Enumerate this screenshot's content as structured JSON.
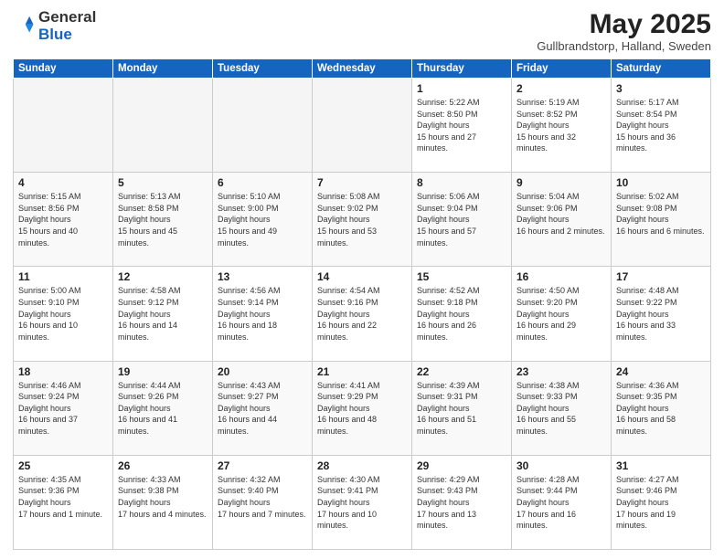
{
  "header": {
    "logo": {
      "line1": "General",
      "line2": "Blue"
    },
    "title": "May 2025",
    "subtitle": "Gullbrandstorp, Halland, Sweden"
  },
  "weekdays": [
    "Sunday",
    "Monday",
    "Tuesday",
    "Wednesday",
    "Thursday",
    "Friday",
    "Saturday"
  ],
  "weeks": [
    [
      {
        "day": "",
        "empty": true
      },
      {
        "day": "",
        "empty": true
      },
      {
        "day": "",
        "empty": true
      },
      {
        "day": "",
        "empty": true
      },
      {
        "day": "1",
        "sunrise": "5:22 AM",
        "sunset": "8:50 PM",
        "daylight": "15 hours and 27 minutes."
      },
      {
        "day": "2",
        "sunrise": "5:19 AM",
        "sunset": "8:52 PM",
        "daylight": "15 hours and 32 minutes."
      },
      {
        "day": "3",
        "sunrise": "5:17 AM",
        "sunset": "8:54 PM",
        "daylight": "15 hours and 36 minutes."
      }
    ],
    [
      {
        "day": "4",
        "sunrise": "5:15 AM",
        "sunset": "8:56 PM",
        "daylight": "15 hours and 40 minutes."
      },
      {
        "day": "5",
        "sunrise": "5:13 AM",
        "sunset": "8:58 PM",
        "daylight": "15 hours and 45 minutes."
      },
      {
        "day": "6",
        "sunrise": "5:10 AM",
        "sunset": "9:00 PM",
        "daylight": "15 hours and 49 minutes."
      },
      {
        "day": "7",
        "sunrise": "5:08 AM",
        "sunset": "9:02 PM",
        "daylight": "15 hours and 53 minutes."
      },
      {
        "day": "8",
        "sunrise": "5:06 AM",
        "sunset": "9:04 PM",
        "daylight": "15 hours and 57 minutes."
      },
      {
        "day": "9",
        "sunrise": "5:04 AM",
        "sunset": "9:06 PM",
        "daylight": "16 hours and 2 minutes."
      },
      {
        "day": "10",
        "sunrise": "5:02 AM",
        "sunset": "9:08 PM",
        "daylight": "16 hours and 6 minutes."
      }
    ],
    [
      {
        "day": "11",
        "sunrise": "5:00 AM",
        "sunset": "9:10 PM",
        "daylight": "16 hours and 10 minutes."
      },
      {
        "day": "12",
        "sunrise": "4:58 AM",
        "sunset": "9:12 PM",
        "daylight": "16 hours and 14 minutes."
      },
      {
        "day": "13",
        "sunrise": "4:56 AM",
        "sunset": "9:14 PM",
        "daylight": "16 hours and 18 minutes."
      },
      {
        "day": "14",
        "sunrise": "4:54 AM",
        "sunset": "9:16 PM",
        "daylight": "16 hours and 22 minutes."
      },
      {
        "day": "15",
        "sunrise": "4:52 AM",
        "sunset": "9:18 PM",
        "daylight": "16 hours and 26 minutes."
      },
      {
        "day": "16",
        "sunrise": "4:50 AM",
        "sunset": "9:20 PM",
        "daylight": "16 hours and 29 minutes."
      },
      {
        "day": "17",
        "sunrise": "4:48 AM",
        "sunset": "9:22 PM",
        "daylight": "16 hours and 33 minutes."
      }
    ],
    [
      {
        "day": "18",
        "sunrise": "4:46 AM",
        "sunset": "9:24 PM",
        "daylight": "16 hours and 37 minutes."
      },
      {
        "day": "19",
        "sunrise": "4:44 AM",
        "sunset": "9:26 PM",
        "daylight": "16 hours and 41 minutes."
      },
      {
        "day": "20",
        "sunrise": "4:43 AM",
        "sunset": "9:27 PM",
        "daylight": "16 hours and 44 minutes."
      },
      {
        "day": "21",
        "sunrise": "4:41 AM",
        "sunset": "9:29 PM",
        "daylight": "16 hours and 48 minutes."
      },
      {
        "day": "22",
        "sunrise": "4:39 AM",
        "sunset": "9:31 PM",
        "daylight": "16 hours and 51 minutes."
      },
      {
        "day": "23",
        "sunrise": "4:38 AM",
        "sunset": "9:33 PM",
        "daylight": "16 hours and 55 minutes."
      },
      {
        "day": "24",
        "sunrise": "4:36 AM",
        "sunset": "9:35 PM",
        "daylight": "16 hours and 58 minutes."
      }
    ],
    [
      {
        "day": "25",
        "sunrise": "4:35 AM",
        "sunset": "9:36 PM",
        "daylight": "17 hours and 1 minute."
      },
      {
        "day": "26",
        "sunrise": "4:33 AM",
        "sunset": "9:38 PM",
        "daylight": "17 hours and 4 minutes."
      },
      {
        "day": "27",
        "sunrise": "4:32 AM",
        "sunset": "9:40 PM",
        "daylight": "17 hours and 7 minutes."
      },
      {
        "day": "28",
        "sunrise": "4:30 AM",
        "sunset": "9:41 PM",
        "daylight": "17 hours and 10 minutes."
      },
      {
        "day": "29",
        "sunrise": "4:29 AM",
        "sunset": "9:43 PM",
        "daylight": "17 hours and 13 minutes."
      },
      {
        "day": "30",
        "sunrise": "4:28 AM",
        "sunset": "9:44 PM",
        "daylight": "17 hours and 16 minutes."
      },
      {
        "day": "31",
        "sunrise": "4:27 AM",
        "sunset": "9:46 PM",
        "daylight": "17 hours and 19 minutes."
      }
    ]
  ]
}
